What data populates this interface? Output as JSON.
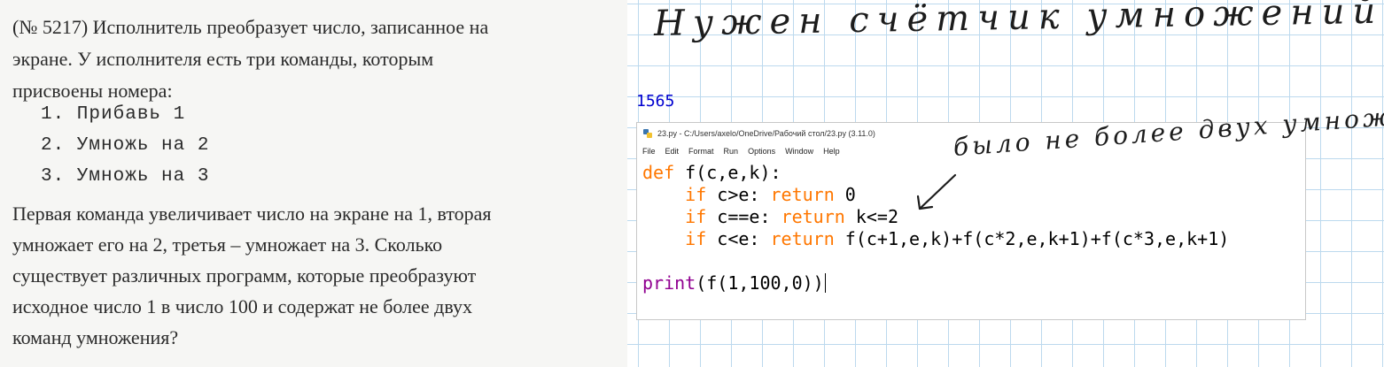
{
  "problem": {
    "lines": [
      "(№ 5217) Исполнитель преобразует число, записанное на",
      "экране. У исполнителя есть три команды, которым",
      "присвоены номера:"
    ],
    "commands": [
      "1. Прибавь 1",
      "2. Умножь на 2",
      "3. Умножь на 3"
    ],
    "question_lines": [
      "Первая команда увеличивает число на экране на 1, вторая",
      "умножает его на 2, третья – умножает на 3. Сколько",
      "существует различных программ, которые преобразуют",
      "исходное число 1 в число 100 и содержат не более двух",
      "команд умножения?"
    ]
  },
  "notes": {
    "title": "Нужен счётчик умножений!",
    "top_scribble": "...  ...  ...  ...",
    "annotation": "было не более двух умножений"
  },
  "shell": {
    "output": "1565"
  },
  "editor": {
    "title": "23.py - C:/Users/axelo/OneDrive/Рабочий стол/23.py (3.11.0)",
    "menu": [
      "File",
      "Edit",
      "Format",
      "Run",
      "Options",
      "Window",
      "Help"
    ],
    "code": {
      "l1_kw": "def",
      "l1_rest": " f(c,e,k):",
      "l2_indent": "    ",
      "l2_kw": "if",
      "l2_mid": " c>e: ",
      "l2_kw2": "return",
      "l2_rest": " 0",
      "l3_kw": "if",
      "l3_mid": " c==e: ",
      "l3_kw2": "return",
      "l3_rest": " k<=2",
      "l4_kw": "if",
      "l4_mid": " c<e: ",
      "l4_kw2": "return",
      "l4_rest": " f(c+1,e,k)+f(c*2,e,k+1)+f(c*3,e,k+1)",
      "l6_bi": "print",
      "l6_rest": "(f(1,100,0))"
    }
  },
  "colors": {
    "keyword": "#ff7700",
    "builtin": "#900090",
    "shell_output": "#0000d0",
    "grid": "#bcd9ee"
  }
}
